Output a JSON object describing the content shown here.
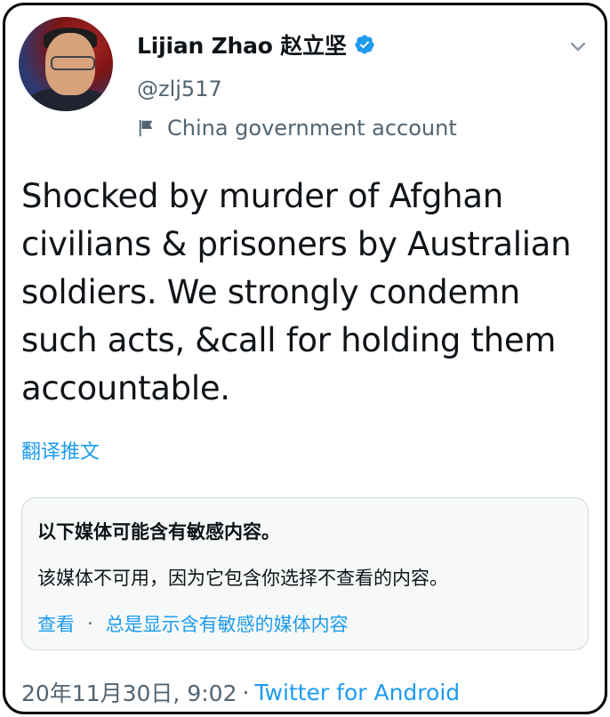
{
  "author": {
    "name": "Lijian Zhao 赵立坚",
    "handle": "@zlj517",
    "label": "China government account",
    "verified": true
  },
  "tweet": {
    "text": "Shocked by murder of Afghan civilians & prisoners by Australian soldiers. We strongly condemn such acts, &call for holding them accountable.",
    "translate": "翻译推文"
  },
  "sensitive_media": {
    "title": "以下媒体可能含有敏感内容。",
    "description": "该媒体不可用，因为它包含你选择不查看的内容。",
    "view": "查看",
    "separator": "·",
    "always_show": "总是显示含有敏感的媒体内容"
  },
  "meta": {
    "timestamp": "20年11月30日, 9:02",
    "separator": "·",
    "source": "Twitter for Android"
  },
  "colors": {
    "accent": "#1d9bf0",
    "secondary_text": "#536471",
    "border": "#cfd9de"
  },
  "icons": {
    "verified": "verified-badge-icon",
    "flag": "flag-icon",
    "chevron": "chevron-down-icon"
  }
}
